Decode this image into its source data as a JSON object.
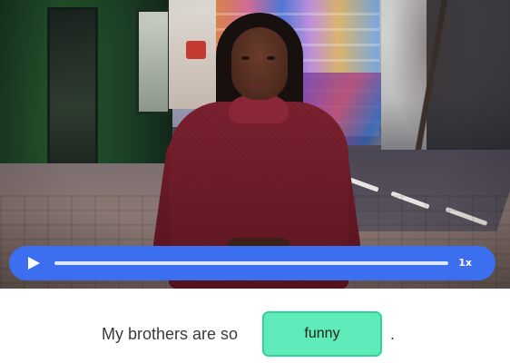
{
  "player": {
    "play_icon": "play-icon",
    "progress": 0,
    "speed_label": "1x",
    "accent_color": "#3c6ff0"
  },
  "exercise": {
    "prefix": "My brothers are so",
    "answer": "funny",
    "suffix": ".",
    "answer_color": "#5eeab9"
  }
}
